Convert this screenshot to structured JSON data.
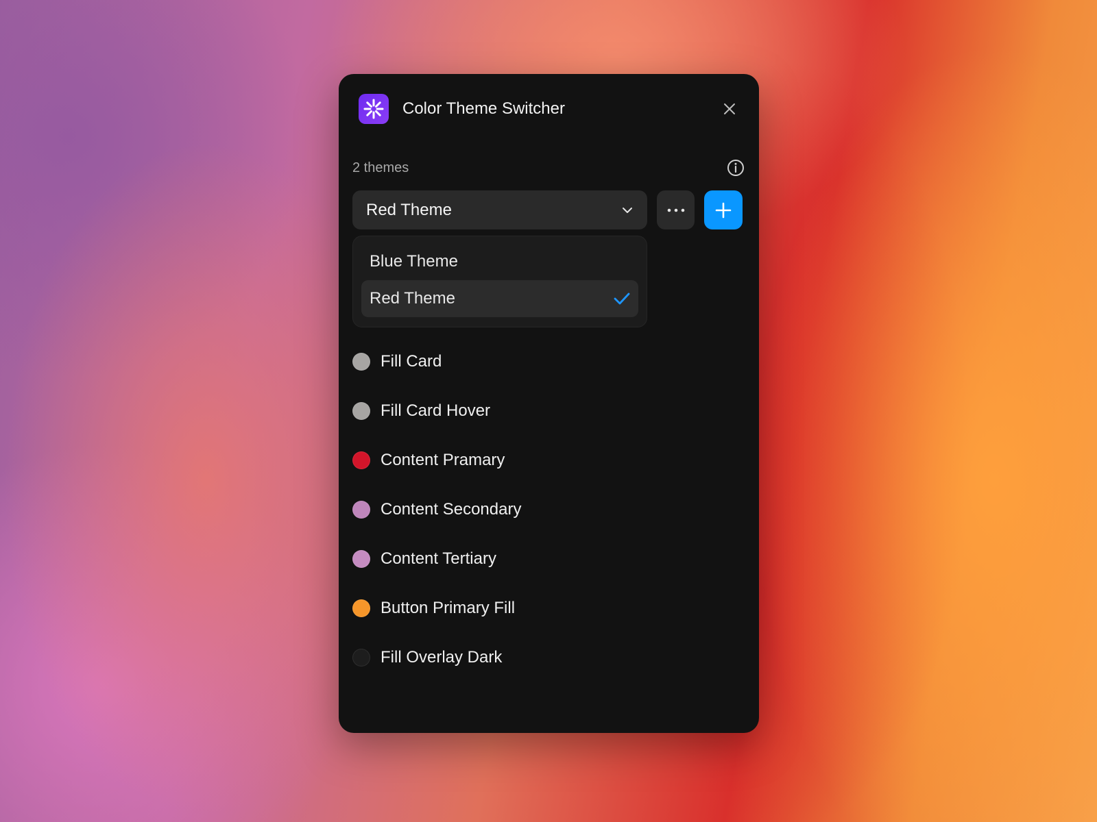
{
  "app": {
    "title": "Color Theme Switcher",
    "icon": "sparkle-logo-icon",
    "accent": "#7a33f2"
  },
  "header": {
    "close_icon": "close-icon"
  },
  "themes": {
    "count_label": "2 themes",
    "selected": "Red Theme",
    "options": [
      {
        "label": "Blue Theme",
        "selected": false
      },
      {
        "label": "Red Theme",
        "selected": true
      }
    ]
  },
  "toolbar": {
    "more_icon": "more-horizontal-icon",
    "add_icon": "plus-icon",
    "add_color": "#0a97ff",
    "check_color": "#1e96ff"
  },
  "colors": [
    {
      "name": "Fill Card",
      "hex": "#a7a5a3"
    },
    {
      "name": "Fill Card Hover",
      "hex": "#a7a5a3"
    },
    {
      "name": "Content Pramary",
      "hex": "#d3152a"
    },
    {
      "name": "Content Secondary",
      "hex": "#bf86bb"
    },
    {
      "name": "Content Tertiary",
      "hex": "#c58cc1"
    },
    {
      "name": "Button Primary Fill",
      "hex": "#f6962a"
    },
    {
      "name": "Fill Overlay Dark",
      "hex": "#1d1d1d"
    }
  ]
}
